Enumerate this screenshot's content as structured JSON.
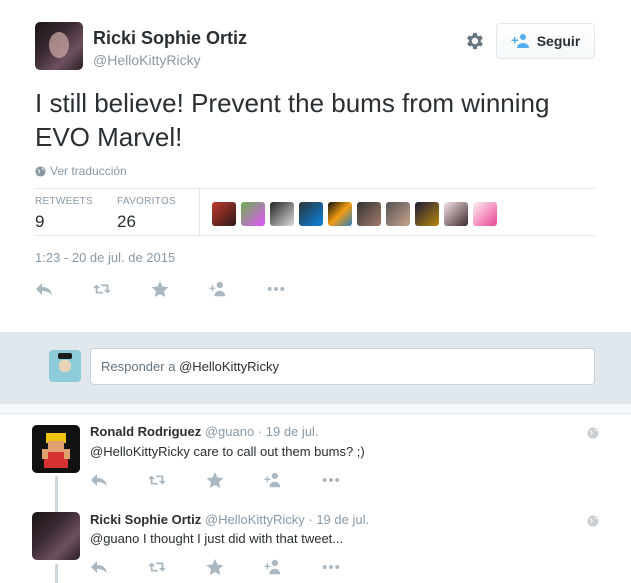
{
  "tweet": {
    "author_name": "Ricki Sophie Ortiz",
    "author_handle": "@HelloKittyRicky",
    "follow_label": "Seguir",
    "text": "I still believe! Prevent the bums from winning EVO Marvel!",
    "translate_label": "Ver traducción",
    "retweets_label": "RETWEETS",
    "retweets_count": "9",
    "favorites_label": "FAVORITOS",
    "favorites_count": "26",
    "timestamp": "1:23 - 20 de jul. de 2015"
  },
  "reply_box": {
    "prefix": "Responder a ",
    "handle": "@HelloKittyRicky"
  },
  "replies": [
    {
      "name": "Ronald Rodriguez",
      "handle": "@guano",
      "time": "· 19 de jul.",
      "text": "@HelloKittyRicky care to call out them bums? ;)"
    },
    {
      "name": "Ricki Sophie Ortiz",
      "handle": "@HelloKittyRicky",
      "time": "· 19 de jul.",
      "text": "@guano I thought I just did with that tweet..."
    }
  ],
  "colors": {
    "text": "#292f33",
    "muted": "#8899a6",
    "icon": "#aab8c2",
    "band": "#e1e8ed"
  }
}
